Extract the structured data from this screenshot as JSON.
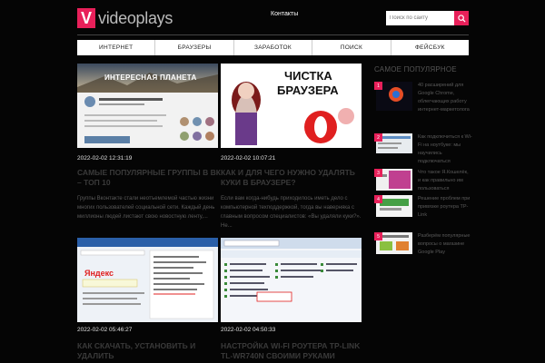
{
  "header": {
    "logo_letter": "V",
    "logo_text": "videoplays",
    "contacts_label": "Контакты",
    "search_placeholder": "Поиск по сайту"
  },
  "nav": {
    "items": [
      "ИНТЕРНЕТ",
      "БРАУЗЕРЫ",
      "ЗАРАБОТОК",
      "ПОИСК",
      "ФЕЙСБУК"
    ]
  },
  "posts": [
    {
      "date": "2022-02-02 12:31:19",
      "title": "САМЫЕ ПОПУЛЯРНЫЕ ГРУППЫ В ВК – ТОП 10",
      "excerpt": "Группы Вконтакте стали неотъемлемой частью жизни многих пользователей социальной сети. Каждый день миллионы людей листают свою новостную ленту,...",
      "thumb_title": "ИНТЕРЕСНАЯ ПЛАНЕТА"
    },
    {
      "date": "2022-02-02 10:07:21",
      "title": "КАК И ДЛЯ ЧЕГО НУЖНО УДАЛЯТЬ КУКИ В БРАУЗЕРЕ?",
      "excerpt": "Если вам когда-нибудь приходилось иметь дело с компьютерной техподдержкой, тогда вы наверняка с главным вопросом специалистов: «Вы удаляли куки?». Не...",
      "thumb_line1": "ЧИСТКА",
      "thumb_line2": "БРАУЗЕРА"
    },
    {
      "date": "2022-02-02 05:46:27",
      "title": "КАК СКАЧАТЬ, УСТАНОВИТЬ И УДАЛИТЬ",
      "thumb_brand": "Яндекс"
    },
    {
      "date": "2022-02-02 04:50:33",
      "title": "НАСТРОЙКА WI-FI РОУТЕРА TP-LINK TL-WR740N СВОИМИ РУКАМИ"
    }
  ],
  "sidebar": {
    "heading": "САМОЕ ПОПУЛЯРНОЕ",
    "items": [
      {
        "num": "1",
        "text": "40 расширений для Google Chrome, облегчающих работу интернет-маркетолога"
      },
      {
        "num": "2",
        "text": "Как подключиться к Wi-Fi на ноутбуке: мы научились подключаться"
      },
      {
        "num": "3",
        "text": "Что такое Я.Кошелёк, и как правильно им пользоваться"
      },
      {
        "num": "4",
        "text": "Решение проблем при привязке роутера TP-Link"
      },
      {
        "num": "5",
        "text": "Разберём популярные вопросы о магазине Google Play"
      }
    ]
  },
  "colors": {
    "accent": "#e8205a",
    "background": "#050505"
  }
}
